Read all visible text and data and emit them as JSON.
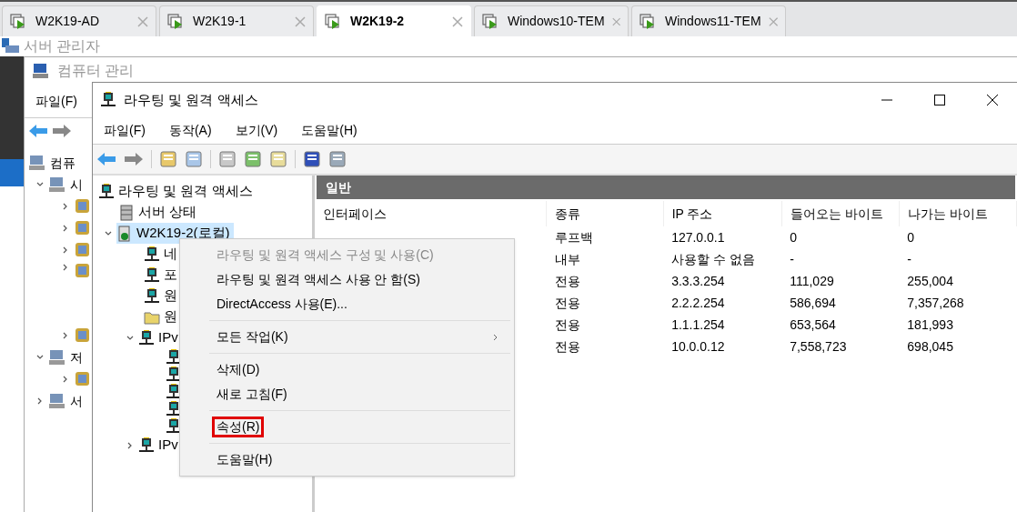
{
  "tabs": [
    {
      "label": "W2K19-AD",
      "selected": false
    },
    {
      "label": "W2K19-1",
      "selected": false
    },
    {
      "label": "W2K19-2",
      "selected": true
    },
    {
      "label": "Windows10-TEM",
      "selected": false
    },
    {
      "label": "Windows11-TEM",
      "selected": false
    }
  ],
  "server_manager": {
    "title": "서버 관리자"
  },
  "computer_management": {
    "title": "컴퓨터 관리",
    "menu": [
      "파일(F)"
    ],
    "tree": [
      {
        "label": "컴퓨"
      },
      {
        "label": "시",
        "expanded": true
      },
      {
        "label": "저",
        "expanded": true
      },
      {
        "label": "서",
        "expanded": false
      }
    ]
  },
  "routing": {
    "title": "라우팅 및 원격 액세스",
    "menu": [
      "파일(F)",
      "동작(A)",
      "보기(V)",
      "도움말(H)"
    ],
    "tree": [
      {
        "label": "라우팅 및 원격 액세스",
        "children": [
          {
            "label": "서버 상태"
          },
          {
            "label": "W2K19-2(로컬)",
            "expanded": true,
            "selected": true,
            "children": [
              {
                "label": "네"
              },
              {
                "label": "포"
              },
              {
                "label": "원"
              },
              {
                "label": "원"
              },
              {
                "label": "IPv",
                "expanded": true
              },
              {
                "label": "IPv",
                "expanded": false
              }
            ]
          }
        ]
      }
    ],
    "panel": {
      "header": "일반",
      "columns": [
        "인터페이스",
        "종류",
        "IP 주소",
        "들어오는 바이트",
        "나가는 바이트"
      ],
      "rows": [
        {
          "type": "루프백",
          "ip": "127.0.0.1",
          "in": "0",
          "out": "0"
        },
        {
          "type": "내부",
          "ip": "사용할 수 없음",
          "in": "-",
          "out": "-"
        },
        {
          "type": "전용",
          "ip": "3.3.3.254",
          "in": "111,029",
          "out": "255,004"
        },
        {
          "type": "전용",
          "ip": "2.2.2.254",
          "in": "586,694",
          "out": "7,357,268"
        },
        {
          "type": "전용",
          "ip": "1.1.1.254",
          "in": "653,564",
          "out": "181,993"
        },
        {
          "type": "전용",
          "ip": "10.0.0.12",
          "in": "7,558,723",
          "out": "698,045"
        }
      ]
    }
  },
  "context_menu": [
    {
      "kind": "item",
      "label": "라우팅 및 원격 액세스 구성 및 사용(C)",
      "disabled": true,
      "submenu": false,
      "highlighted": false
    },
    {
      "kind": "item",
      "label": "라우팅 및 원격 액세스 사용 안 함(S)",
      "disabled": false,
      "submenu": false,
      "highlighted": false
    },
    {
      "kind": "item",
      "label": "DirectAccess 사용(E)...",
      "disabled": false,
      "submenu": false,
      "highlighted": false
    },
    {
      "kind": "separator"
    },
    {
      "kind": "item",
      "label": "모든 작업(K)",
      "disabled": false,
      "submenu": true,
      "highlighted": false
    },
    {
      "kind": "separator"
    },
    {
      "kind": "item",
      "label": "삭제(D)",
      "disabled": false,
      "submenu": false,
      "highlighted": false
    },
    {
      "kind": "item",
      "label": "새로 고침(F)",
      "disabled": false,
      "submenu": false,
      "highlighted": false
    },
    {
      "kind": "separator"
    },
    {
      "kind": "item",
      "label": "속성(R)",
      "disabled": false,
      "submenu": false,
      "highlighted": true
    },
    {
      "kind": "separator"
    },
    {
      "kind": "item",
      "label": "도움말(H)",
      "disabled": false,
      "submenu": false,
      "highlighted": false
    }
  ]
}
